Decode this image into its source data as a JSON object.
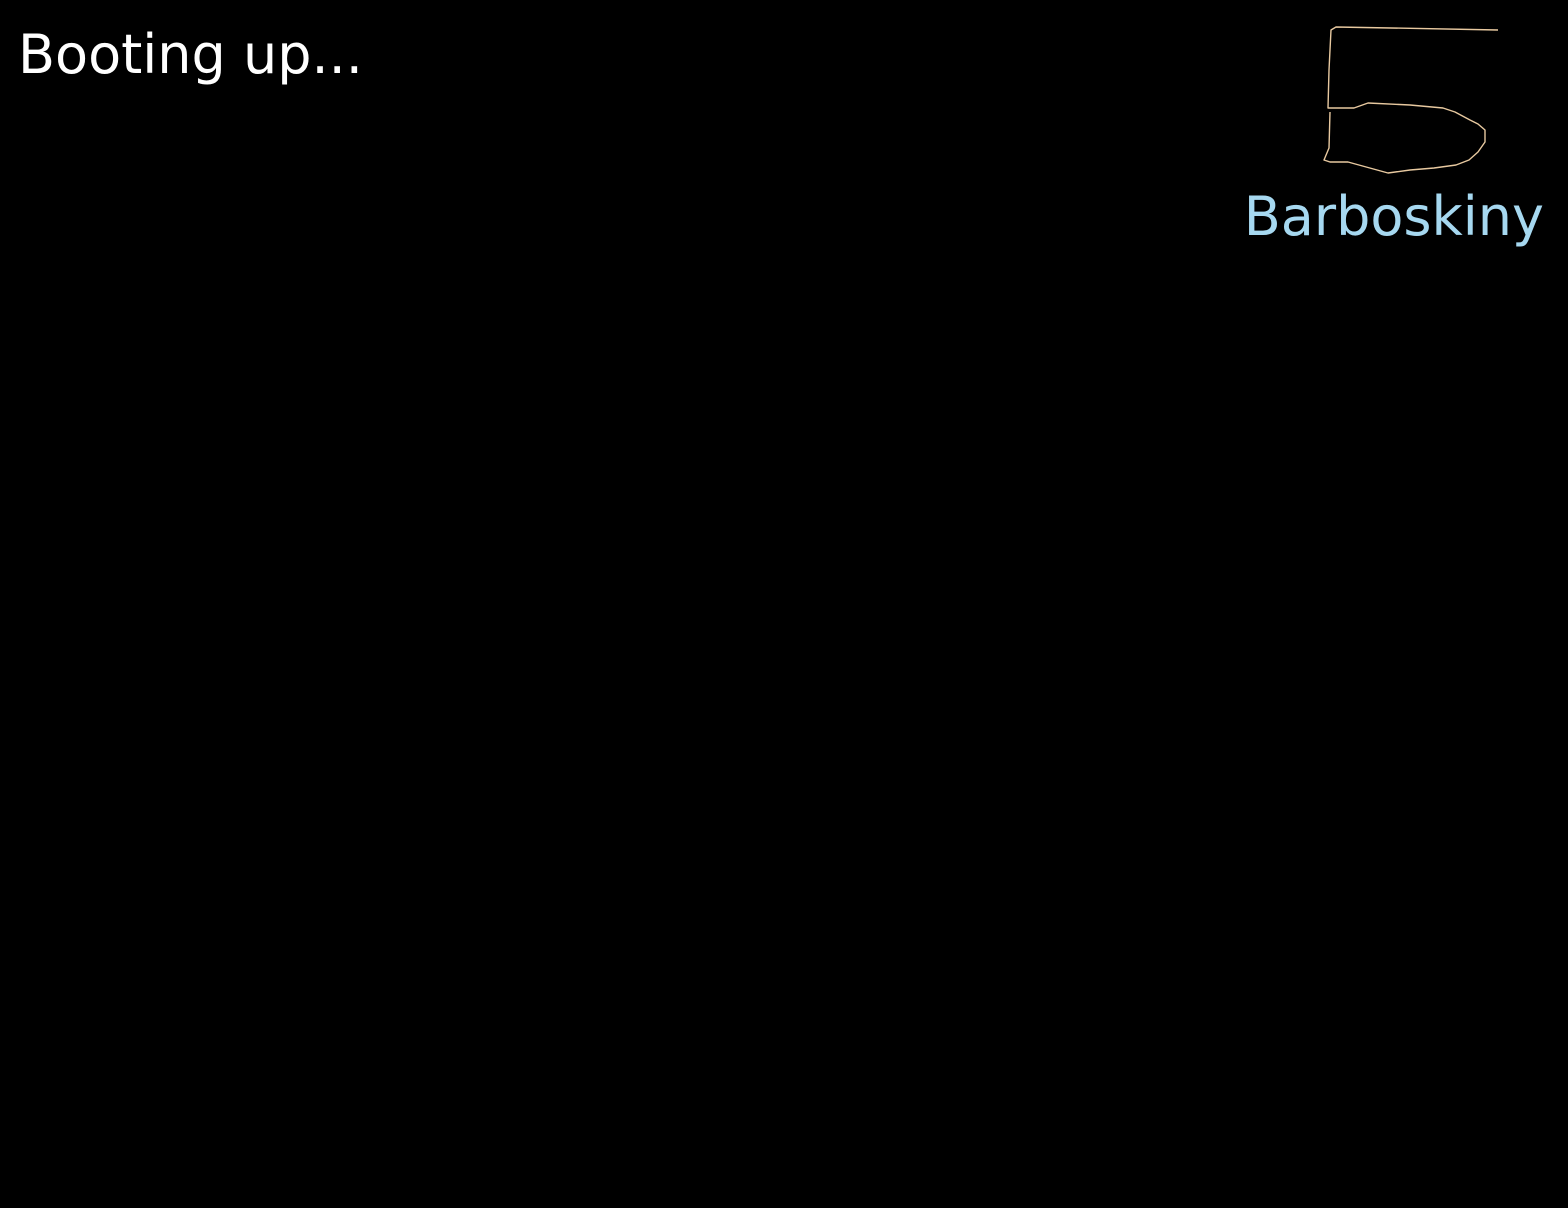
{
  "boot": {
    "status_text": "Booting up..."
  },
  "logo": {
    "icon": "stylized-five-logo-icon",
    "name": "Barboskiny",
    "name_color": "#a6d8f0",
    "outline_color": "#e8c9a0"
  },
  "colors": {
    "background": "#000000",
    "text": "#ffffff"
  }
}
